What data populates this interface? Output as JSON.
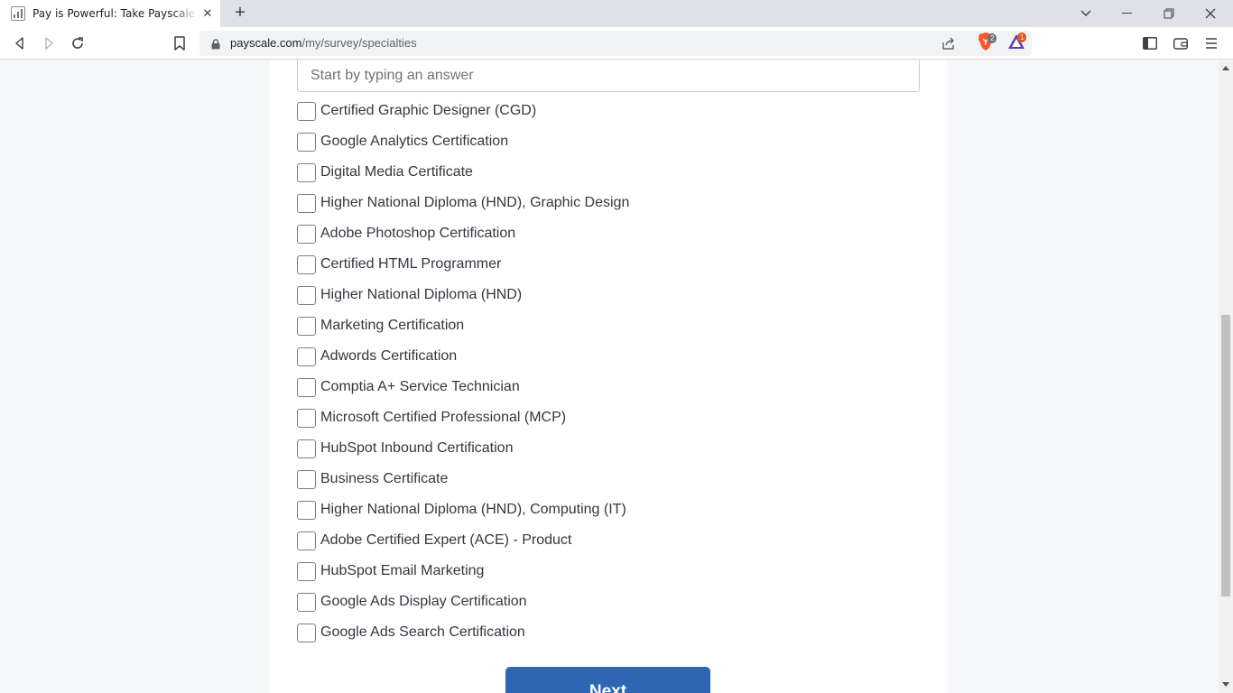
{
  "browser": {
    "tab_title": "Pay is Powerful: Take Payscale's Online Salary Survey",
    "new_tab_label": "+",
    "url_domain": "payscale.com",
    "url_path": "/my/survey/specialties",
    "brave_shields_count": "2",
    "rewards_count": "1"
  },
  "survey": {
    "search_placeholder": "Start by typing an answer",
    "options": [
      "Certified Graphic Designer (CGD)",
      "Google Analytics Certification",
      "Digital Media Certificate",
      "Higher National Diploma (HND), Graphic Design",
      "Adobe Photoshop Certification",
      "Certified HTML Programmer",
      "Higher National Diploma (HND)",
      "Marketing Certification",
      "Adwords Certification",
      "Comptia A+ Service Technician",
      "Microsoft Certified Professional (MCP)",
      "HubSpot Inbound Certification",
      "Business Certificate",
      "Higher National Diploma (HND), Computing (IT)",
      "Adobe Certified Expert (ACE) - Product",
      "HubSpot Email Marketing",
      "Google Ads Display Certification",
      "Google Ads Search Certification"
    ],
    "next_label": "Next"
  },
  "colors": {
    "primary_button": "#2f66b3",
    "brave_badge": "#e2531f"
  }
}
